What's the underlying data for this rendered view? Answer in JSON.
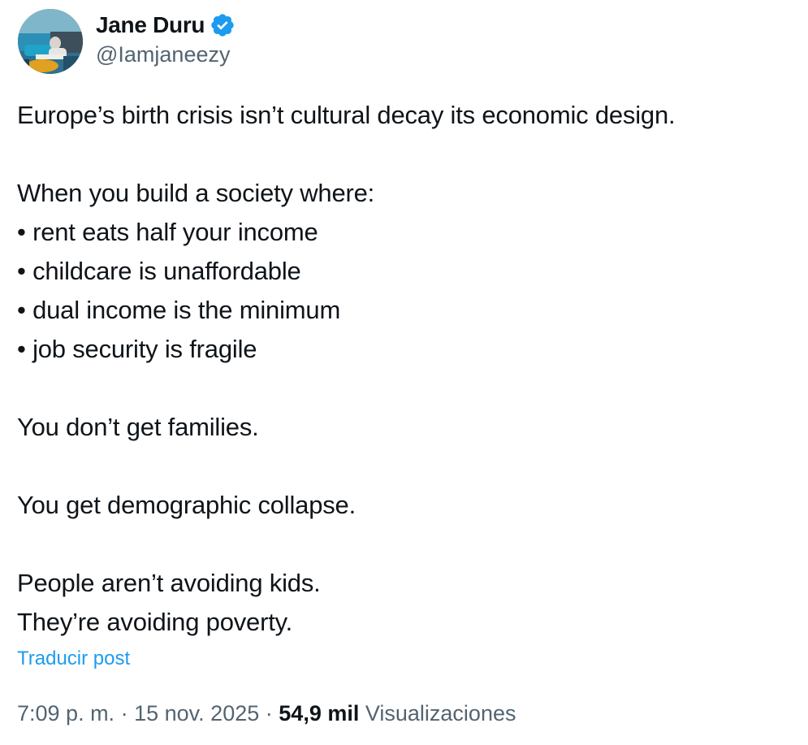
{
  "author": {
    "display_name": "Jane Duru",
    "handle": "@Iamjaneezy",
    "verified_icon": "verified-badge-icon",
    "badge_color": "#1d9bf0"
  },
  "post": {
    "lines": [
      "Europe’s birth crisis isn’t cultural decay its economic design.",
      "",
      "When you build a society where:",
      "• rent eats half your income",
      "• childcare is unaffordable",
      "• dual income is the minimum",
      "• job security is fragile",
      "",
      "You don’t get families.",
      "",
      "You get demographic collapse.",
      "",
      "People aren’t avoiding kids.",
      "They’re avoiding poverty."
    ],
    "translate_label": "Traducir post"
  },
  "meta": {
    "time": "7:09 p. m.",
    "separator": "·",
    "date": "15 nov. 2025",
    "views_count": "54,9 mil",
    "views_label": "Visualizaciones"
  },
  "colors": {
    "text": "#0f1419",
    "secondary": "#536471",
    "link": "#1d9bf0"
  }
}
